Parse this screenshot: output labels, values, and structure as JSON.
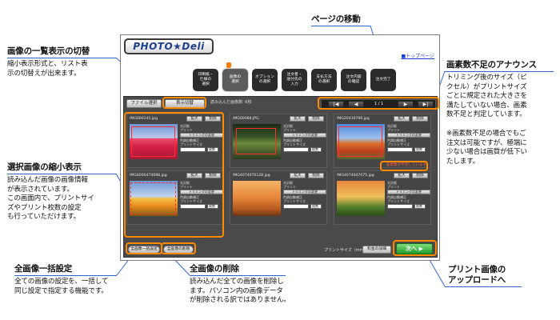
{
  "annotations": {
    "list_toggle": {
      "title": "画像の一覧表示の切替",
      "body": [
        "縮小表示形式と、リスト表",
        "示の切替えが出来ます。"
      ]
    },
    "page_move": {
      "title": "ページの移動"
    },
    "pixel_warning": {
      "title": "画素数不足のアナウンス",
      "body": [
        "トリミング後のサイズ（ピ",
        "クセル）がプリントサイズ",
        "ごとに規定された大きさを",
        "満たしていない場合、画素",
        "数不足と判定しています。"
      ],
      "note": [
        "※画素数不足の場合でもご",
        "注文は可能ですが、極端に",
        "少ない場合は画質が低下い",
        "たします。"
      ]
    },
    "thumbnail": {
      "title": "選択画像の縮小表示",
      "body": [
        "読み込んだ画像の画像情報",
        "が表示されています。",
        "この画面内で、プリントサイ",
        "ズやプリント枚数の設定",
        "も行っていただけます。"
      ]
    },
    "bulk": {
      "title": "全画像一括設定",
      "body": [
        "全ての画像の設定を、一括して",
        "同じ設定で指定する機能です。"
      ]
    },
    "delete_all": {
      "title": "全画像の削除",
      "body": [
        "読み込んだ全ての画像を削除し",
        "ます。パソコン内の画像データ",
        "が削除される訳ではありません。"
      ]
    },
    "upload": {
      "title": [
        "プリント画像の",
        "アップロードへ"
      ]
    }
  },
  "app": {
    "logo": "PHOTO★Deli",
    "top_link": "■トップページ",
    "steps": [
      {
        "label": "印刷紙・\n仕様の\n選択"
      },
      {
        "label": "画像の\n選択"
      },
      {
        "label": "オプション\nの選択"
      },
      {
        "label": "注文者・\n送付先の\n入力"
      },
      {
        "label": "支払方法\nの選択"
      },
      {
        "label": "注文内容\nの確認"
      },
      {
        "label": "注文完了"
      }
    ],
    "toolbar": {
      "file_select": "ファイル選択",
      "view_toggle": "表示切替",
      "loaded_info": "読み込んだ画像数: 6枚"
    },
    "pager": {
      "first": "|◀",
      "prev": "◀",
      "info": "1 / 1",
      "next": "▶",
      "last": "▶|"
    },
    "cards": [
      {
        "filename": "IMG000141.jpg",
        "zoom": "拡大",
        "delete": "削除",
        "paper": "光沢紙",
        "print": "プリント",
        "trim": "トリミングの変更",
        "auto": "色調自動補正",
        "size": "プリントサイズ",
        "qty": "枚数"
      },
      {
        "filename": "IMG00088.JPG",
        "zoom": "拡大",
        "delete": "削除",
        "paper": "光沢紙",
        "print": "プリント",
        "trim": "トリミングの変更",
        "auto": "色調自動補正",
        "size": "プリントサイズ",
        "qty": "枚数"
      },
      {
        "filename": "IMG20430796.jpg",
        "zoom": "拡大",
        "delete": "削除",
        "paper": "光沢紙",
        "print": "プリント",
        "trim": "トリミングの変更",
        "auto": "色調自動補正",
        "size": "プリントサイズ",
        "qty": "枚数",
        "warning": "画素数が不足しています"
      },
      {
        "filename": "IMG4000474098.jpg",
        "zoom": "拡大",
        "delete": "削除",
        "paper": "光沢紙",
        "print": "プリント",
        "trim": "トリミングの変更",
        "auto": "色調自動補正",
        "size": "プリントサイズ",
        "qty": "枚数"
      },
      {
        "filename": "IMG4074070128.jpg",
        "zoom": "拡大",
        "delete": "削除",
        "paper": "光沢紙",
        "print": "プリント",
        "trim": "トリミングの変更",
        "auto": "色調自動補正",
        "size": "プリントサイズ",
        "qty": "枚数"
      },
      {
        "filename": "IMG4074047075.jpg",
        "zoom": "拡大",
        "delete": "削除",
        "paper": "光沢紙",
        "print": "プリント",
        "trim": "トリミングの変更",
        "auto": "色調自動補正",
        "size": "プリントサイズ",
        "qty": "枚数"
      }
    ],
    "bottom": {
      "bulk_button": "全画像一括設定",
      "delete_all_button": "全画像の削除",
      "print_size_label": "プリントサイズ（mm）",
      "print_size_button": "料金の詳細",
      "next_button": "次へ ▶"
    }
  },
  "colors": {
    "highlight": "#ff8a00",
    "annotation_line": "#2e66d4",
    "next": "#1f9a2a",
    "warning": "#ff5a3c"
  }
}
